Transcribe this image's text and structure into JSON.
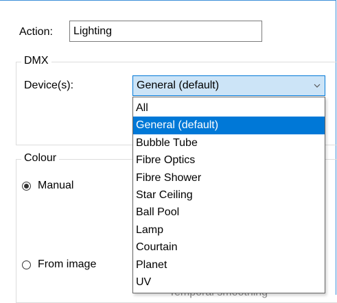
{
  "action": {
    "label": "Action:",
    "value": "Lighting"
  },
  "dmx": {
    "legend": "DMX",
    "device_label": "Device(s):",
    "selected": "General (default)",
    "arrow_icon": "chevron-down-icon",
    "options": [
      "All",
      "General (default)",
      "Bubble Tube",
      "Fibre Optics",
      "Fibre Shower",
      "Star Ceiling",
      "Ball Pool",
      "Lamp",
      "Courtain",
      "Planet",
      "UV"
    ],
    "highlighted_index": 1
  },
  "colour": {
    "legend": "Colour",
    "manual_label": "Manual",
    "manual_checked": true,
    "from_image_label": "From image",
    "from_image_checked": false,
    "obscured_text": "Temporal smoothing"
  },
  "colors": {
    "selection_blue": "#0078d7",
    "select_bg": "#cce4f7",
    "window_border": "#3c8ed8"
  }
}
